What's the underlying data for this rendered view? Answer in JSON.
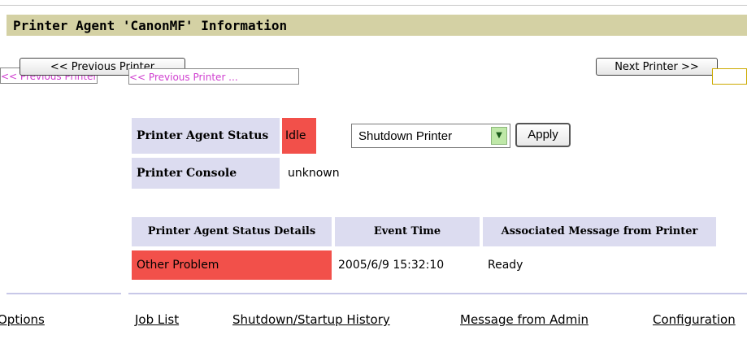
{
  "header": {
    "title": "Printer Agent 'CanonMF' Information"
  },
  "nav": {
    "previous_label": "<< Previous Printer",
    "next_label": "Next Printer >>",
    "ghost_previous": "<< Previous Printer ...",
    "ghost_left": "<< Previous Printer"
  },
  "status": {
    "agent_status_label": "Printer Agent Status",
    "agent_status_value": "Idle",
    "console_label": "Printer Console",
    "console_value": "unknown",
    "action_select": "Shutdown Printer",
    "apply_label": "Apply"
  },
  "details_table": {
    "headers": [
      "Printer Agent Status Details",
      "Event Time",
      "Associated Message from Printer"
    ],
    "rows": [
      {
        "status": "Other Problem",
        "time": "2005/6/9 15:32:10",
        "message": "Ready"
      }
    ]
  },
  "bottom_links": [
    "Options",
    "Job List",
    "Shutdown/Startup History",
    "Message from Admin",
    "Configuration"
  ],
  "colors": {
    "title_bg": "#d4d1a4",
    "label_bg": "#dcdcf0",
    "alert_red": "#f2504a"
  }
}
